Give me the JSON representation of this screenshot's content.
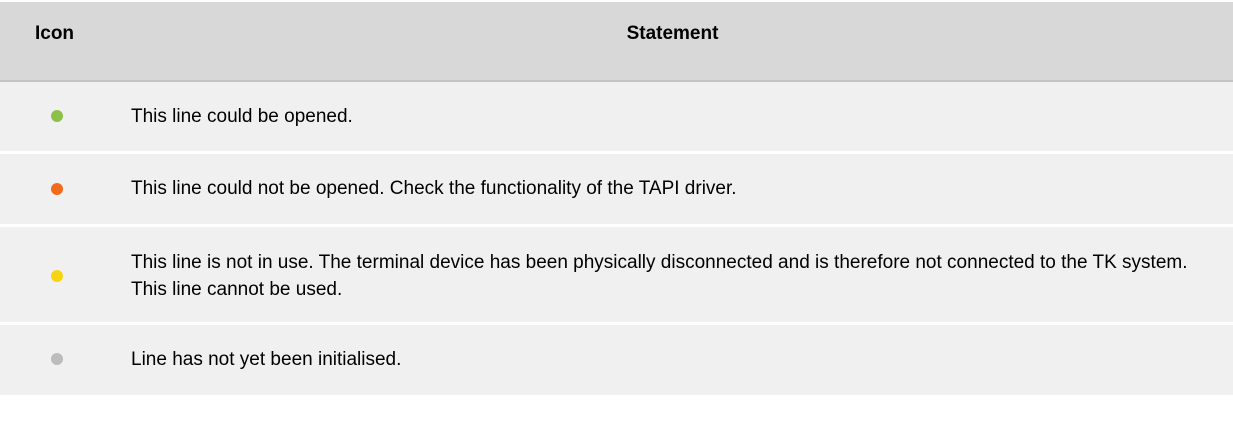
{
  "header": {
    "icon_label": "Icon",
    "statement_label": "Statement"
  },
  "rows": [
    {
      "icon": "green-status-dot",
      "color": "#8dc04a",
      "statement": "This line could be opened."
    },
    {
      "icon": "orange-status-dot",
      "color": "#f46a1c",
      "statement": "This line could not be opened. Check the functionality of the TAPI driver."
    },
    {
      "icon": "yellow-status-dot",
      "color": "#f7d411",
      "statement": "This line is not in use. The terminal device has been physically disconnected and is therefore not connected to the TK system. This line cannot be used."
    },
    {
      "icon": "grey-status-dot",
      "color": "#bcbcbc",
      "statement": "Line has not yet been initialised."
    }
  ]
}
